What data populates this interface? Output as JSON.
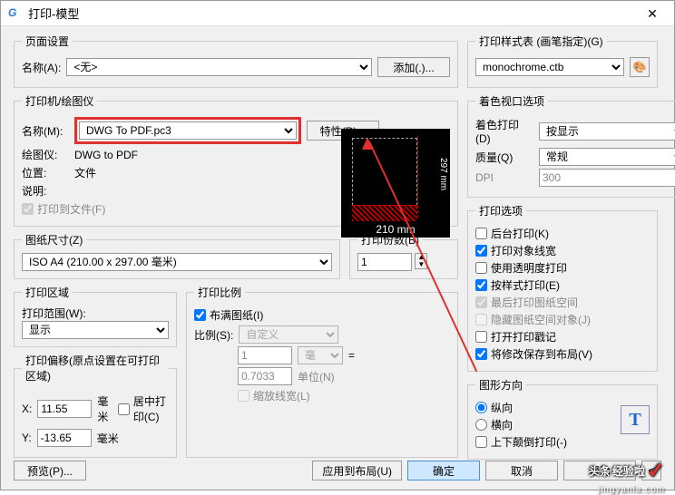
{
  "window": {
    "title": "打印-模型"
  },
  "page_setup": {
    "legend": "页面设置",
    "name_label": "名称(A):",
    "name_value": "<无>",
    "add_btn": "添加(.)..."
  },
  "printer": {
    "legend": "打印机/绘图仪",
    "name_label": "名称(M):",
    "name_value": "DWG To PDF.pc3",
    "props_btn": "特性(R)...",
    "plotter_label": "绘图仪:",
    "plotter_value": "DWG to PDF",
    "location_label": "位置:",
    "location_value": "文件",
    "desc_label": "说明:",
    "to_file": "打印到文件(F)",
    "preview_w": "210 mm",
    "preview_h": "297 mm"
  },
  "paper": {
    "legend": "图纸尺寸(Z)",
    "value": "ISO A4 (210.00 x 297.00 毫米)"
  },
  "copies": {
    "legend": "打印份数(B)",
    "value": "1"
  },
  "area": {
    "legend": "打印区域",
    "range_label": "打印范围(W):",
    "range_value": "显示"
  },
  "scale": {
    "legend": "打印比例",
    "fit": "布满图纸(I)",
    "ratio_label": "比例(S):",
    "ratio_value": "自定义",
    "unit_count": "1",
    "unit_label": "毫米",
    "unit_equals": "=",
    "drawing_units": "0.7033",
    "drawing_units_label": "单位(N)",
    "scale_lw": "缩放线宽(L)"
  },
  "offset": {
    "legend": "打印偏移(原点设置在可打印区域)",
    "x_label": "X:",
    "x_value": "11.55",
    "y_label": "Y:",
    "y_value": "-13.65",
    "unit": "毫米",
    "center": "居中打印(C)"
  },
  "style_table": {
    "legend": "打印样式表 (画笔指定)(G)",
    "value": "monochrome.ctb"
  },
  "shaded": {
    "legend": "着色视口选项",
    "shade_label": "着色打印(D)",
    "shade_value": "按显示",
    "quality_label": "质量(Q)",
    "quality_value": "常规",
    "dpi_label": "DPI",
    "dpi_value": "300"
  },
  "options": {
    "legend": "打印选项",
    "bg": "后台打印(K)",
    "lw": "打印对象线宽",
    "transp": "使用透明度打印",
    "style": "按样式打印(E)",
    "last_space": "最后打印图纸空间",
    "hide_space": "隐藏图纸空间对象(J)",
    "stamp": "打开打印戳记",
    "save": "将修改保存到布局(V)"
  },
  "orient": {
    "legend": "图形方向",
    "portrait": "纵向",
    "landscape": "横向",
    "upside": "上下颠倒打印(-)"
  },
  "footer": {
    "preview": "预览(P)...",
    "apply": "应用到布局(U)",
    "ok": "确定",
    "cancel": "取消",
    "help_tip": "帮助"
  },
  "watermark": {
    "text": "经验啦",
    "sub": "jingyanla.com"
  }
}
